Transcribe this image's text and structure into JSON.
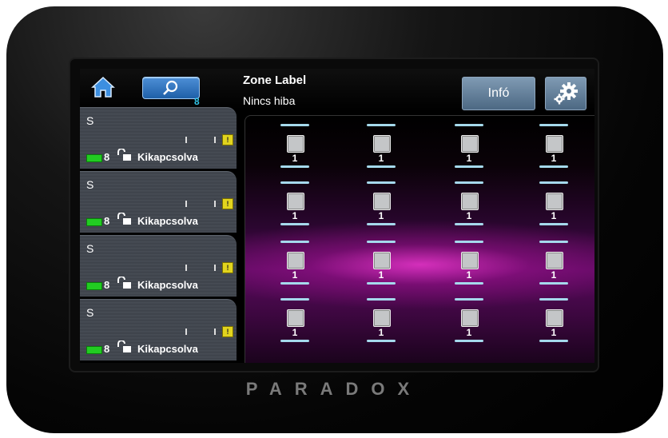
{
  "header": {
    "zone_title": "Zone Label",
    "status": "Nincs hiba",
    "search_count": "8",
    "info_label": "Infó"
  },
  "areas": [
    {
      "name": "S",
      "count": "8",
      "status": "Kikapcsolva",
      "warn": "!"
    },
    {
      "name": "S",
      "count": "8",
      "status": "Kikapcsolva",
      "warn": "!"
    },
    {
      "name": "S",
      "count": "8",
      "status": "Kikapcsolva",
      "warn": "!"
    },
    {
      "name": "S",
      "count": "8",
      "status": "Kikapcsolva",
      "warn": "!"
    }
  ],
  "zones": [
    [
      "1",
      "1",
      "1",
      "1"
    ],
    [
      "1",
      "1",
      "1",
      "1"
    ],
    [
      "1",
      "1",
      "1",
      "1"
    ],
    [
      "1",
      "1",
      "1",
      "1"
    ]
  ],
  "brand": "PARADOX",
  "colors": {
    "accent_blue": "#1e5fa8",
    "zone_bar": "#a5d9ec",
    "status_green": "#22cc22",
    "warn_yellow": "#e2d41e",
    "info_button": "#4c6883"
  }
}
